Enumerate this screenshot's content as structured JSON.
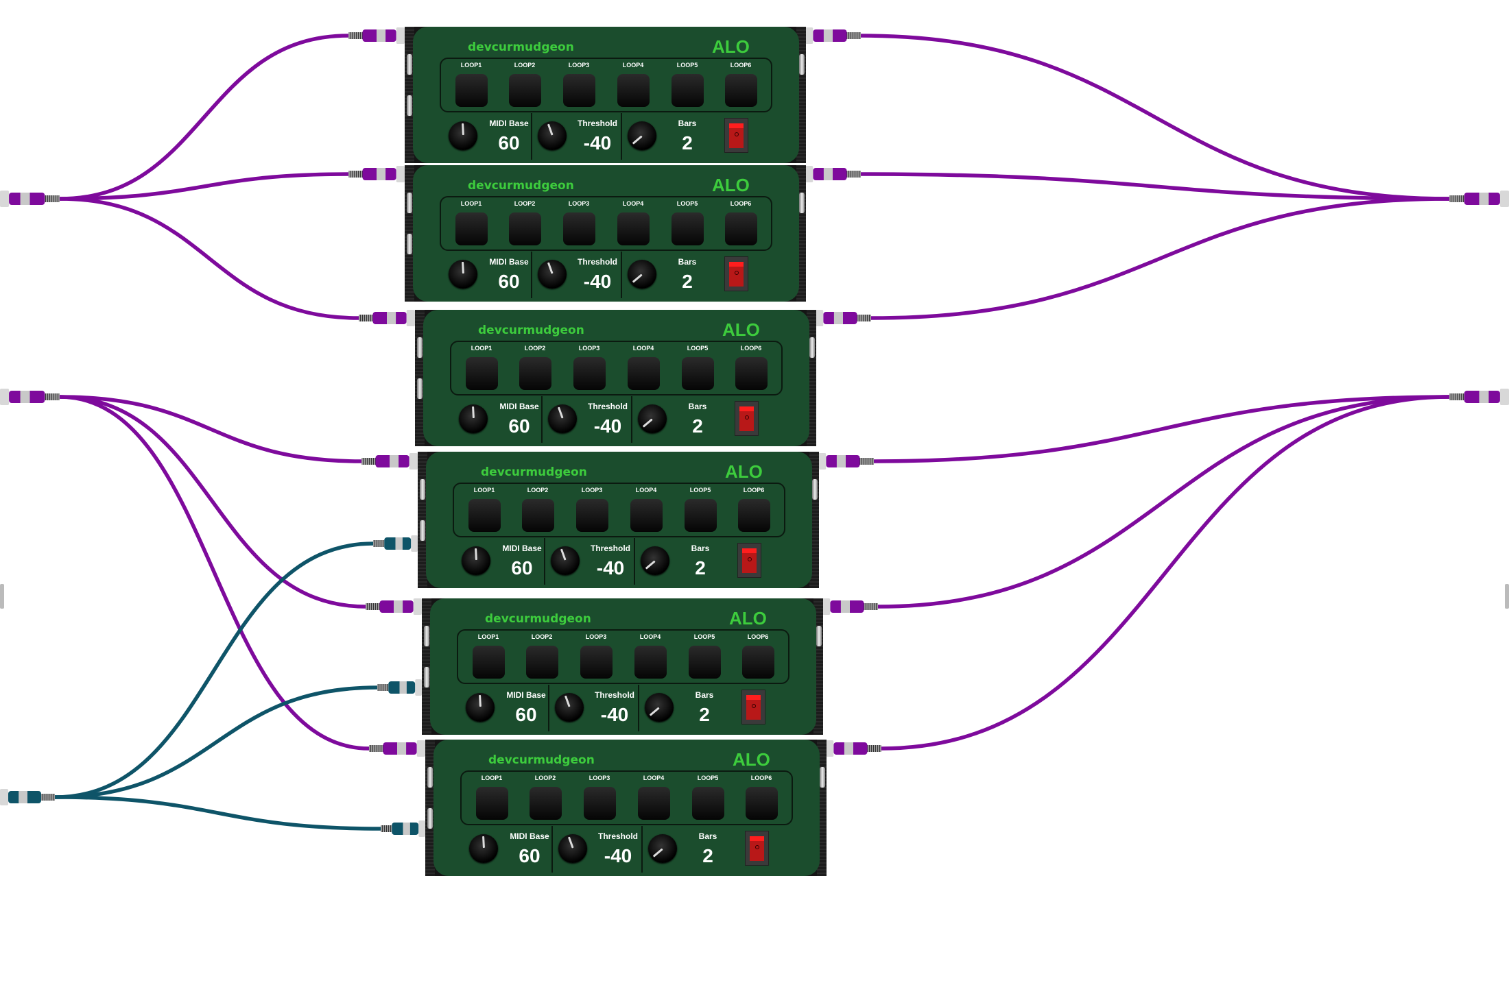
{
  "colors": {
    "audio_cable": "#7e0a9c",
    "midi_cable": "#0e5468",
    "panel": "#1b4d2d",
    "brand_text": "#3dcc3d"
  },
  "modules": [
    {
      "brand": "devcurmudgeon",
      "title": "ALO",
      "loops": [
        "LOOP1",
        "LOOP2",
        "LOOP3",
        "LOOP4",
        "LOOP5",
        "LOOP6"
      ],
      "midi_base_label": "MIDI Base",
      "midi_base": "60",
      "threshold_label": "Threshold",
      "threshold": "-40",
      "bars_label": "Bars",
      "bars": "2",
      "power": "off"
    },
    {
      "brand": "devcurmudgeon",
      "title": "ALO",
      "loops": [
        "LOOP1",
        "LOOP2",
        "LOOP3",
        "LOOP4",
        "LOOP5",
        "LOOP6"
      ],
      "midi_base_label": "MIDI Base",
      "midi_base": "60",
      "threshold_label": "Threshold",
      "threshold": "-40",
      "bars_label": "Bars",
      "bars": "2",
      "power": "off"
    },
    {
      "brand": "devcurmudgeon",
      "title": "ALO",
      "loops": [
        "LOOP1",
        "LOOP2",
        "LOOP3",
        "LOOP4",
        "LOOP5",
        "LOOP6"
      ],
      "midi_base_label": "MIDI Base",
      "midi_base": "60",
      "threshold_label": "Threshold",
      "threshold": "-40",
      "bars_label": "Bars",
      "bars": "2",
      "power": "off"
    },
    {
      "brand": "devcurmudgeon",
      "title": "ALO",
      "loops": [
        "LOOP1",
        "LOOP2",
        "LOOP3",
        "LOOP4",
        "LOOP5",
        "LOOP6"
      ],
      "midi_base_label": "MIDI Base",
      "midi_base": "60",
      "threshold_label": "Threshold",
      "threshold": "-40",
      "bars_label": "Bars",
      "bars": "2",
      "power": "off"
    },
    {
      "brand": "devcurmudgeon",
      "title": "ALO",
      "loops": [
        "LOOP1",
        "LOOP2",
        "LOOP3",
        "LOOP4",
        "LOOP5",
        "LOOP6"
      ],
      "midi_base_label": "MIDI Base",
      "midi_base": "60",
      "threshold_label": "Threshold",
      "threshold": "-40",
      "bars_label": "Bars",
      "bars": "2",
      "power": "off"
    },
    {
      "brand": "devcurmudgeon",
      "title": "ALO",
      "loops": [
        "LOOP1",
        "LOOP2",
        "LOOP3",
        "LOOP4",
        "LOOP5",
        "LOOP6"
      ],
      "midi_base_label": "MIDI Base",
      "midi_base": "60",
      "threshold_label": "Threshold",
      "threshold": "-40",
      "bars_label": "Bars",
      "bars": "2",
      "power": "off"
    }
  ]
}
